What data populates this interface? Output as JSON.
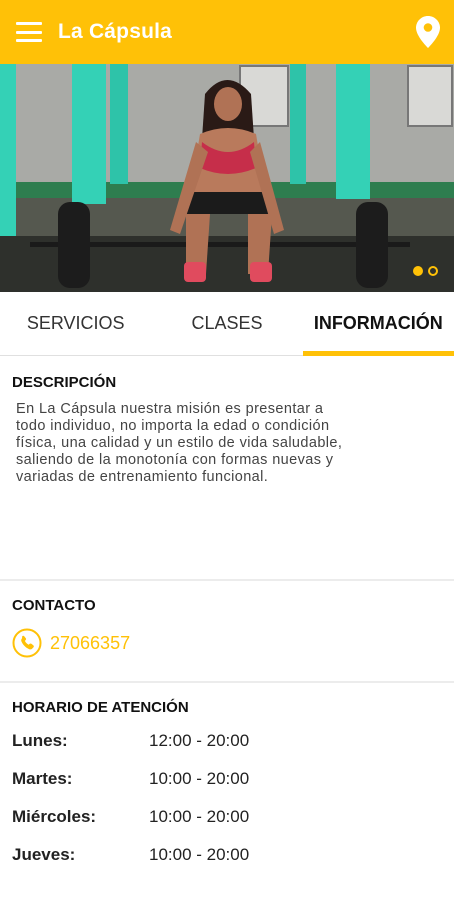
{
  "appbar": {
    "title": "La Cápsula",
    "menu_icon": "menu-icon",
    "location_icon": "location-pin-icon"
  },
  "colors": {
    "accent": "#FFC107",
    "text": "#212121"
  },
  "carousel": {
    "slides": 2,
    "active": 1
  },
  "tabs": [
    {
      "label": "SERVICIOS",
      "active": false
    },
    {
      "label": "CLASES",
      "active": false
    },
    {
      "label": "INFORMACIÓN",
      "active": true
    }
  ],
  "description": {
    "title": "DESCRIPCIÓN",
    "lines": [
      "En La Cápsula nuestra misión es presentar a",
      "todo individuo, no importa la edad o condición",
      "física, una calidad y un estilo de vida saludable,",
      "saliendo de la monotonía con formas nuevas y",
      "variadas de entrenamiento funcional."
    ]
  },
  "contact": {
    "title": "CONTACTO",
    "phone": "27066357",
    "phone_icon": "phone-icon"
  },
  "hours": {
    "title": "HORARIO DE ATENCIÓN",
    "rows": [
      {
        "day": "Lunes:",
        "time": "12:00 - 20:00"
      },
      {
        "day": "Martes:",
        "time": "10:00 - 20:00"
      },
      {
        "day": "Miércoles:",
        "time": "10:00 - 20:00"
      },
      {
        "day": "Jueves:",
        "time": "10:00 - 20:00"
      }
    ]
  }
}
